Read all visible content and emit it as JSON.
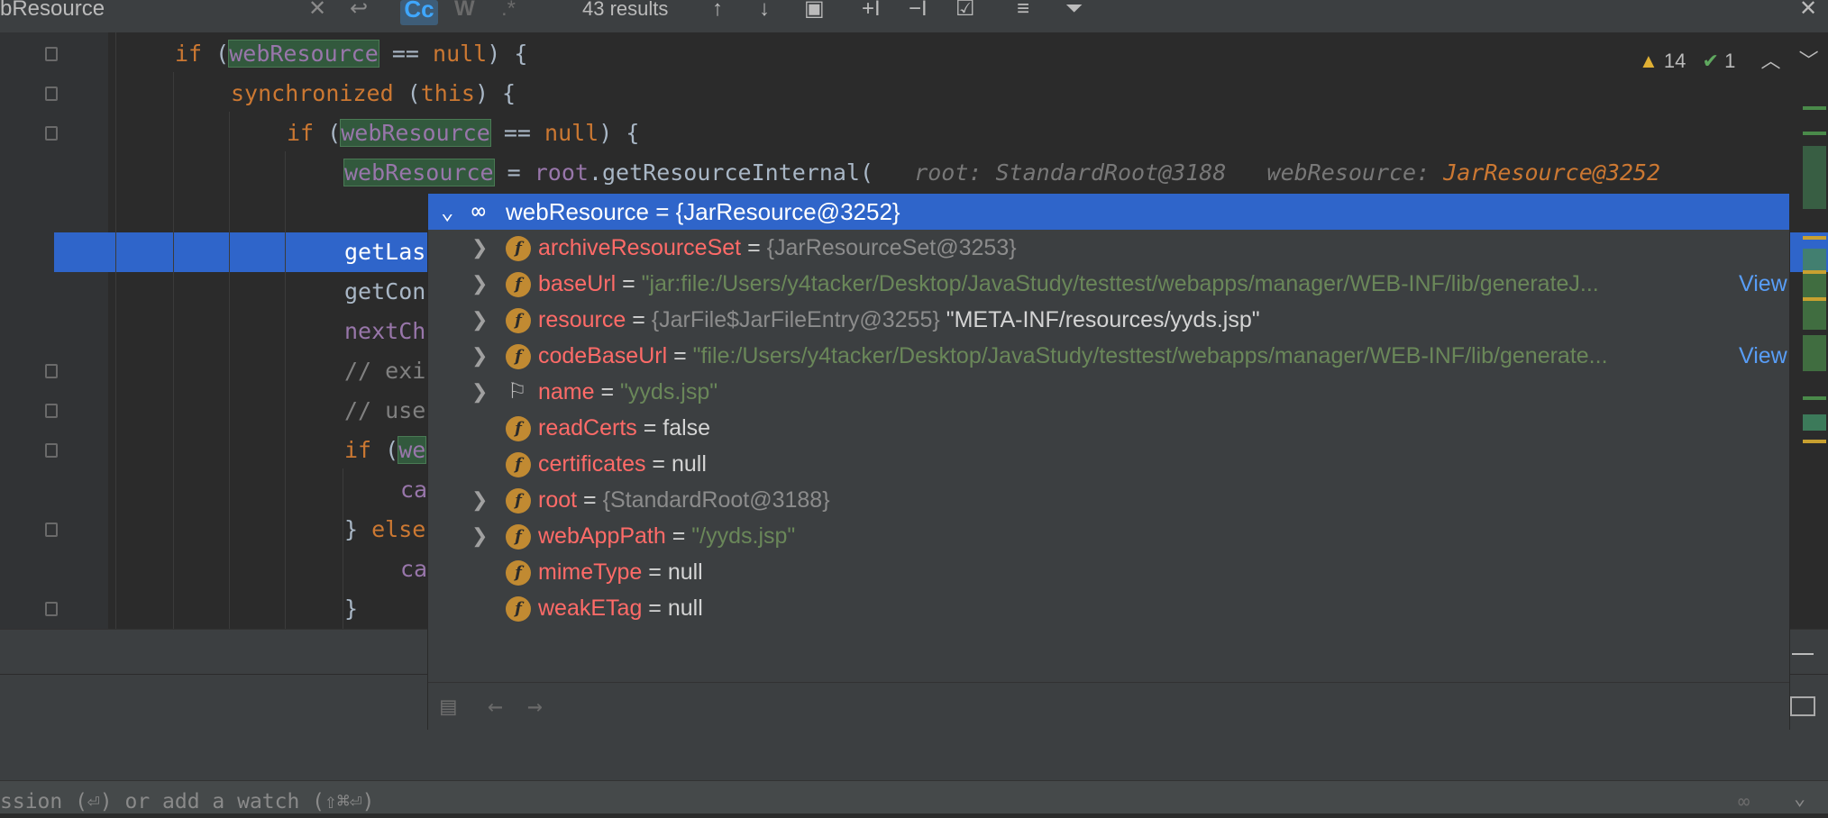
{
  "search": {
    "query": "bResource",
    "results": "43 results",
    "case_label": "Cc",
    "word_label": "W",
    "regex_label": ".*"
  },
  "status": {
    "warnings": "14",
    "checks": "1"
  },
  "code": {
    "l1_kw": "if",
    "l1_a": " (",
    "l1_field": "webResource",
    "l1_b": " == ",
    "l1_null": "null",
    "l1_c": ") {",
    "l2_kw": "synchronized",
    "l2_a": " (",
    "l2_this": "this",
    "l2_b": ") {",
    "l3_kw": "if",
    "l3_a": " (",
    "l3_field": "webResource",
    "l3_b": " == ",
    "l3_null": "null",
    "l3_c": ") {",
    "l4_field": "webResource",
    "l4_a": " = ",
    "l4_root": "root",
    "l4_b": ".getResourceInternal(",
    "l4_hint1": "root: StandardRoot@3188",
    "l4_hint2": "webResource: ",
    "l4_hint3": "JarResource@3252",
    "l6": "getLas",
    "l7": "getCon",
    "l8": "nextCh",
    "l9": "// exi",
    "l10": "// use",
    "l11_kw": "if",
    "l11_a": " (",
    "l11_field": "we",
    "l12": "ca",
    "l13_a": "} ",
    "l13_kw": "else",
    "l14": "ca",
    "l15": "}"
  },
  "popup": {
    "title": "webResource = {JarResource@3252}",
    "rows": [
      {
        "name": "archiveResourceSet",
        "eq": " = ",
        "value": "{JarResourceSet@3253}",
        "extra": "",
        "link": ""
      },
      {
        "name": "baseUrl",
        "eq": " = ",
        "value": "\"jar:file:/Users/y4tacker/Desktop/JavaStudy/testtest/webapps/manager/WEB-INF/lib/generateJ...",
        "extra": "",
        "link": "View"
      },
      {
        "name": "resource",
        "eq": " = ",
        "value": "{JarFile$JarFileEntry@3255}",
        "extra": " \"META-INF/resources/yyds.jsp\"",
        "link": ""
      },
      {
        "name": "codeBaseUrl",
        "eq": " = ",
        "value": "\"file:/Users/y4tacker/Desktop/JavaStudy/testtest/webapps/manager/WEB-INF/lib/generate...",
        "extra": "",
        "link": "View"
      },
      {
        "name": "name",
        "eq": " = ",
        "value": "\"yyds.jsp\"",
        "extra": "",
        "link": ""
      },
      {
        "name": "readCerts",
        "eq": " = ",
        "value": "false",
        "extra": "",
        "link": ""
      },
      {
        "name": "certificates",
        "eq": " = ",
        "value": "null",
        "extra": "",
        "link": ""
      },
      {
        "name": "root",
        "eq": " = ",
        "value": "{StandardRoot@3188}",
        "extra": "",
        "link": ""
      },
      {
        "name": "webAppPath",
        "eq": " = ",
        "value": "\"/yyds.jsp\"",
        "extra": "",
        "link": ""
      },
      {
        "name": "mimeType",
        "eq": " = ",
        "value": "null",
        "extra": "",
        "link": ""
      },
      {
        "name": "weakETag",
        "eq": " = ",
        "value": "null",
        "extra": "",
        "link": ""
      }
    ]
  },
  "watch_hint": "ssion (⏎) or add a watch (⇧⌘⏎)",
  "icons": {
    "badge_letter": "f",
    "chevron_right": "›",
    "chevron_down": "⌄",
    "flag": "⚐",
    "glasses": "∞"
  }
}
